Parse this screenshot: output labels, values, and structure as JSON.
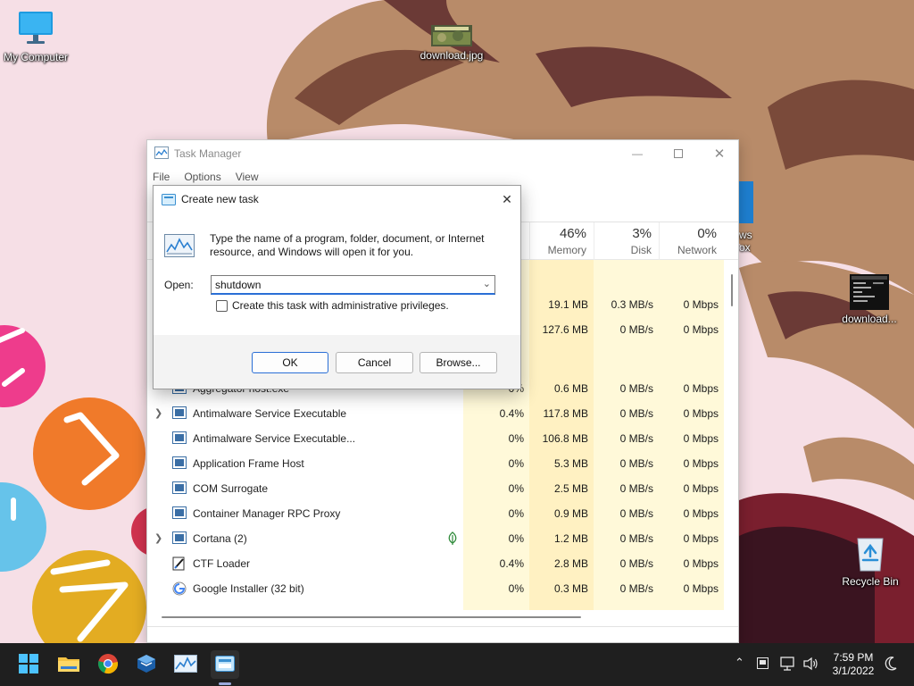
{
  "desktop": {
    "icons": {
      "my_computer": "My Computer",
      "download_jpg": "download.jpg",
      "download_ellipsis": "download...",
      "recycle_bin": "Recycle Bin",
      "partial_label_1": "ws",
      "partial_label_2": "Prox"
    }
  },
  "task_manager": {
    "title": "Task Manager",
    "menu": [
      "File",
      "Options",
      "View"
    ],
    "columns": {
      "memory": {
        "pct": "46%",
        "label": "Memory"
      },
      "disk": {
        "pct": "3%",
        "label": "Disk"
      },
      "network": {
        "pct": "0%",
        "label": "Network"
      }
    },
    "partial_top_rows": [
      {
        "memory": "19.1 MB",
        "disk": "0.3 MB/s",
        "network": "0 Mbps"
      },
      {
        "memory": "127.6 MB",
        "disk": "0 MB/s",
        "network": "0 Mbps"
      }
    ],
    "rows": [
      {
        "name": "Aggregator host.exe",
        "cpu": "0%",
        "memory": "0.6 MB",
        "disk": "0 MB/s",
        "network": "0 Mbps"
      },
      {
        "name": "Antimalware Service Executable",
        "cpu": "0.4%",
        "memory": "117.8 MB",
        "disk": "0 MB/s",
        "network": "0 Mbps"
      },
      {
        "name": "Antimalware Service Executable...",
        "cpu": "0%",
        "memory": "106.8 MB",
        "disk": "0 MB/s",
        "network": "0 Mbps"
      },
      {
        "name": "Application Frame Host",
        "cpu": "0%",
        "memory": "5.3 MB",
        "disk": "0 MB/s",
        "network": "0 Mbps"
      },
      {
        "name": "COM Surrogate",
        "cpu": "0%",
        "memory": "2.5 MB",
        "disk": "0 MB/s",
        "network": "0 Mbps"
      },
      {
        "name": "Container Manager RPC Proxy",
        "cpu": "0%",
        "memory": "0.9 MB",
        "disk": "0 MB/s",
        "network": "0 Mbps"
      },
      {
        "name": "Cortana (2)",
        "cpu": "0%",
        "memory": "1.2 MB",
        "disk": "0 MB/s",
        "network": "0 Mbps"
      },
      {
        "name": "CTF Loader",
        "cpu": "0.4%",
        "memory": "2.8 MB",
        "disk": "0 MB/s",
        "network": "0 Mbps"
      },
      {
        "name": "Google Installer (32 bit)",
        "cpu": "0%",
        "memory": "0.3 MB",
        "disk": "0 MB/s",
        "network": "0 Mbps"
      }
    ]
  },
  "dialog": {
    "title": "Create new task",
    "description": "Type the name of a program, folder, document, or Internet resource, and Windows will open it for you.",
    "open_label": "Open:",
    "open_value": "shutdown",
    "admin_checkbox_label": "Create this task with administrative privileges.",
    "ok_label": "OK",
    "cancel_label": "Cancel",
    "browse_label": "Browse..."
  },
  "taskbar": {
    "time": "7:59 PM",
    "date": "3/1/2022"
  },
  "colors": {
    "accent": "#2a6fd6",
    "heat_light": "#fff9d9",
    "heat_mid": "#fff1c2",
    "taskbar": "#1f1f1f"
  }
}
